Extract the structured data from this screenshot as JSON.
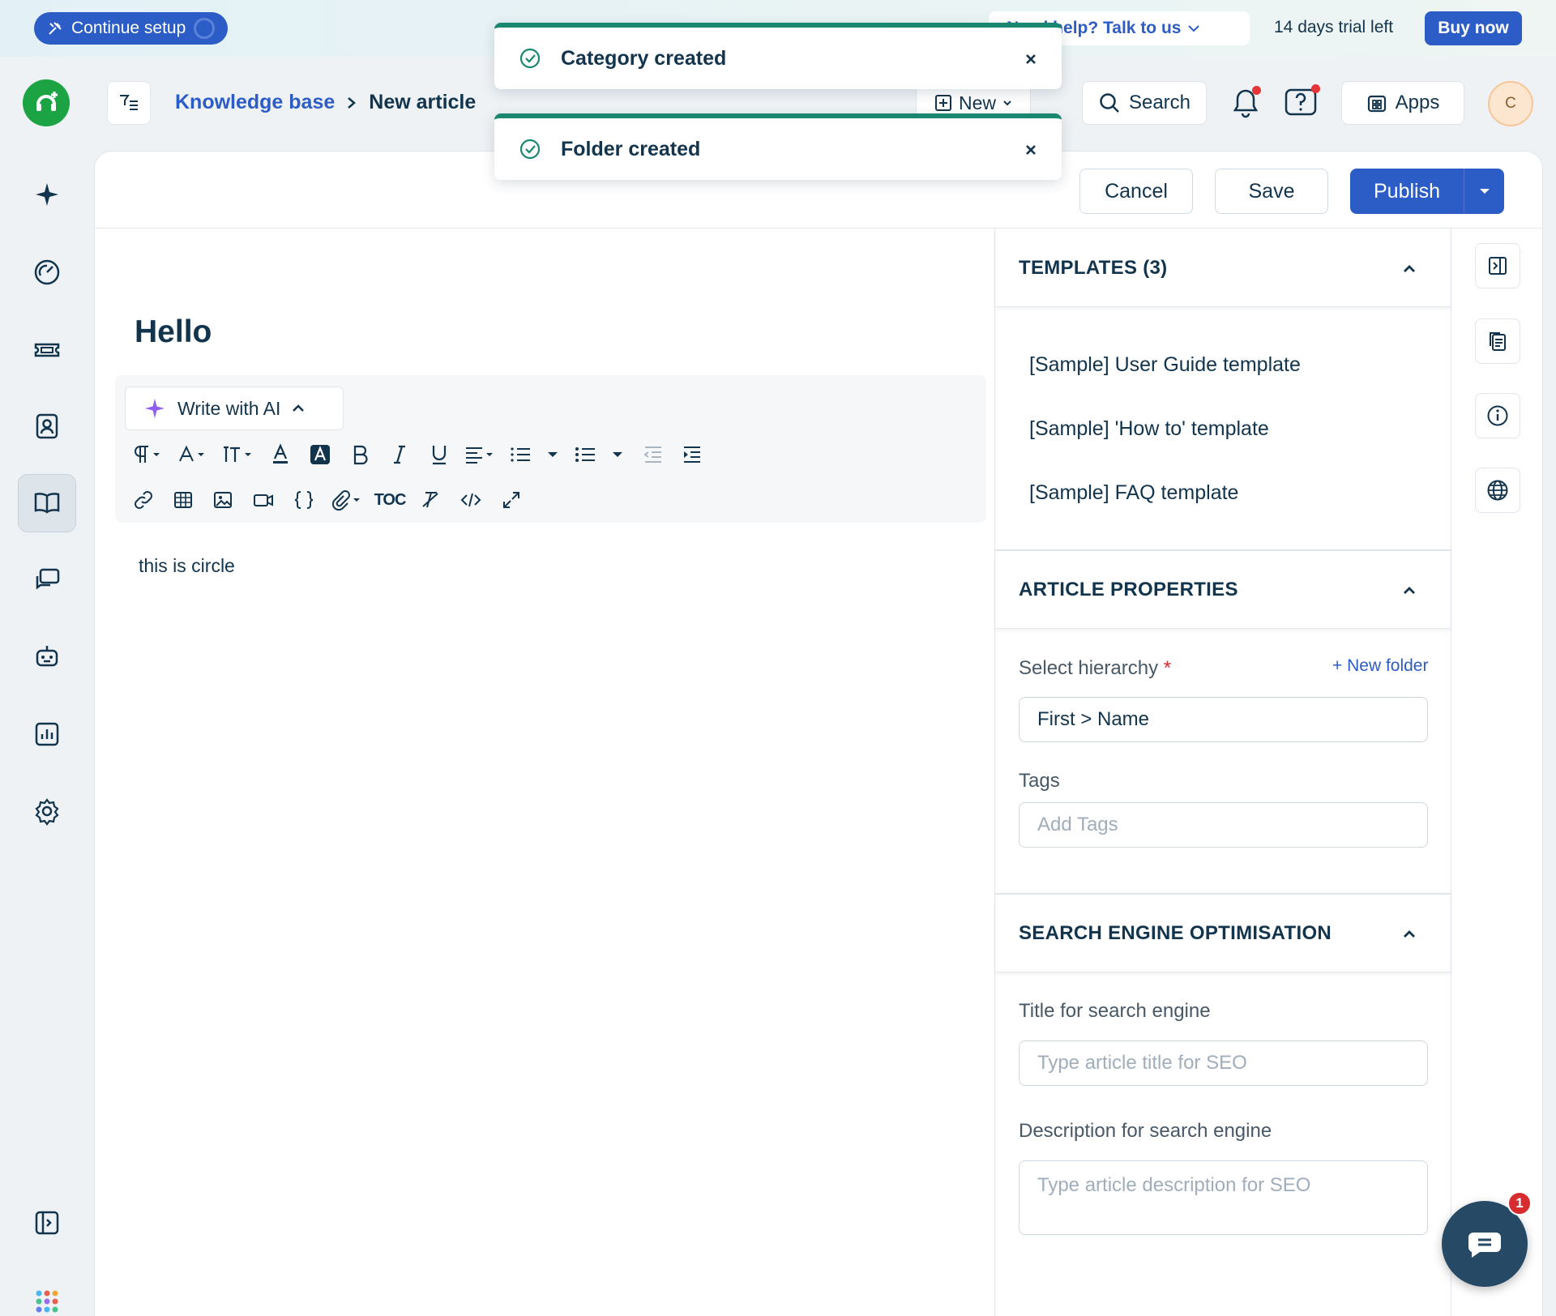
{
  "topbar": {
    "continue_setup": "Continue setup",
    "help_text": "Need help? Talk to us",
    "trial_text": "14 days trial left",
    "buy_now": "Buy now"
  },
  "header": {
    "breadcrumb_root": "Knowledge base",
    "breadcrumb_current": "New article",
    "new_button": "New",
    "search_label": "Search",
    "apps_label": "Apps",
    "avatar_initial": "C"
  },
  "toasts": [
    {
      "message": "Category created"
    },
    {
      "message": "Folder created"
    }
  ],
  "actions": {
    "cancel": "Cancel",
    "save": "Save",
    "publish": "Publish"
  },
  "editor": {
    "title": "Hello",
    "write_ai": "Write with AI",
    "toc_label": "TOC",
    "body_text": "this is circle"
  },
  "templates": {
    "heading": "TEMPLATES (3)",
    "items": [
      "[Sample] User Guide template",
      "[Sample] 'How to' template",
      "[Sample] FAQ template"
    ]
  },
  "properties": {
    "heading": "ARTICLE PROPERTIES",
    "hierarchy_label": "Select hierarchy",
    "required_mark": "*",
    "new_folder": "+ New folder",
    "hierarchy_value": "First > Name",
    "tags_label": "Tags",
    "tags_placeholder": "Add Tags"
  },
  "seo": {
    "heading": "SEARCH ENGINE OPTIMISATION",
    "title_label": "Title for search engine",
    "title_placeholder": "Type article title for SEO",
    "desc_label": "Description for search engine",
    "desc_placeholder": "Type article description for SEO"
  },
  "chat": {
    "badge": "1"
  },
  "colors": {
    "primary": "#2c5cc5",
    "success": "#1a8770",
    "brand_green": "#1ca344",
    "danger": "#d72d30"
  }
}
